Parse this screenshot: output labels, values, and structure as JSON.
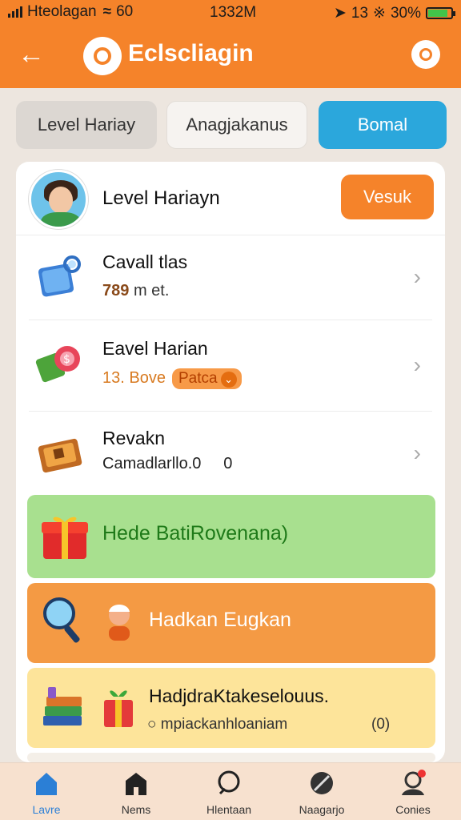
{
  "status_bar": {
    "carrier": "Hteolagan",
    "signal_extra": "60",
    "time": "1332M",
    "indicators": "13",
    "battery": "30%"
  },
  "header": {
    "app_title": "Eclscliagin",
    "back_icon": "back-arrow-icon",
    "chat_icon": "chat-icon",
    "accent": "#f5832a"
  },
  "tabs": [
    {
      "label": "Level Hariay"
    },
    {
      "label": "Anagjakanus"
    },
    {
      "label": "Bomal"
    }
  ],
  "level_row": {
    "title": "Level Hariayn",
    "button": "Vesuk"
  },
  "items": [
    {
      "title": "Cavall tlas",
      "sub_value": "789",
      "sub_unit": "m et.",
      "icon": "magnifier-card-icon"
    },
    {
      "title": "Eavel Harian",
      "sub_value": "13. Bove",
      "pill": "Patca",
      "icon": "gear-coin-icon"
    },
    {
      "title": "Revakn",
      "sub_value": "Camadlarllo.0",
      "sub_extra": "0",
      "icon": "treasure-book-icon"
    }
  ],
  "bands": [
    {
      "text": "Hede BatiRovenana)",
      "icon": "gift-box-icon",
      "color": "#a8e08f"
    },
    {
      "text": "Hadkan Eugkan",
      "icon": "magnifier-icon",
      "color": "#f49a44"
    },
    {
      "title": "HadjdraKtakeselouus.",
      "sub": "mpiackanhloaniam",
      "extra": "(0)",
      "icon": "books-gift-icon",
      "color": "#fde49a"
    }
  ],
  "nav": [
    {
      "label": "Lavre",
      "icon": "home-icon"
    },
    {
      "label": "Nems",
      "icon": "store-icon"
    },
    {
      "label": "Hlentaan",
      "icon": "search-icon"
    },
    {
      "label": "Naagarjo",
      "icon": "leaf-icon"
    },
    {
      "label": "Conies",
      "icon": "profile-icon"
    }
  ]
}
